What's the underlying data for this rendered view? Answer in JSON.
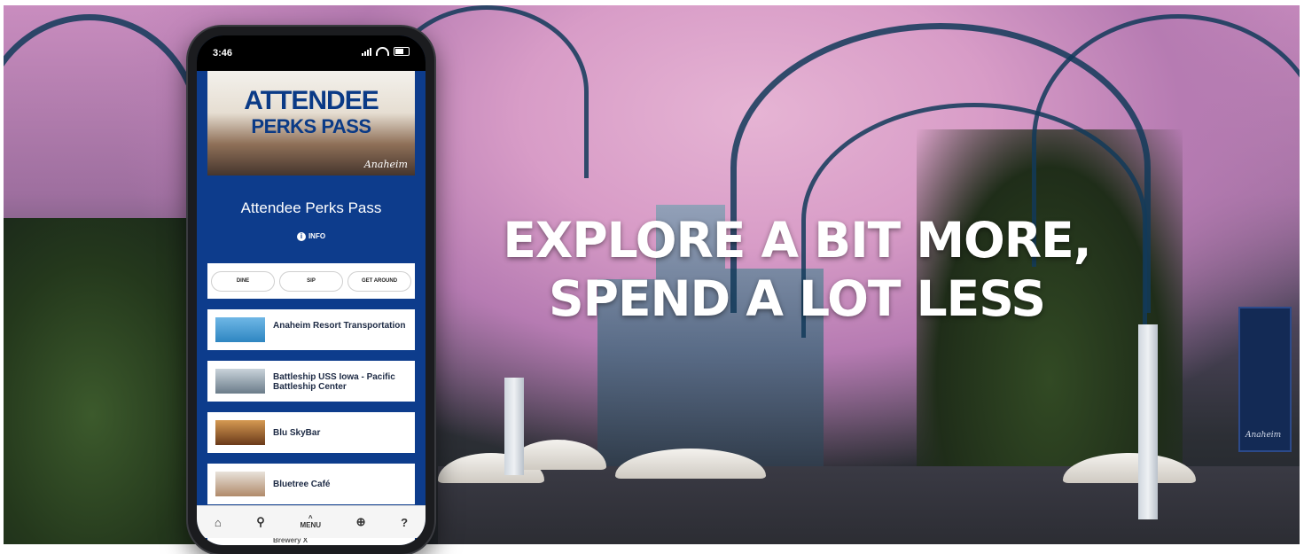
{
  "hero": {
    "headline_line1": "EXPLORE A BIT MORE,",
    "headline_line2": "SPEND A LOT LESS",
    "banner_signature": "Anaheim"
  },
  "phone": {
    "status_time": "3:46",
    "promo": {
      "title_line1": "ATTENDEE",
      "title_line2": "PERKS PASS",
      "logo_text": "Anaheim"
    },
    "section_title": "Attendee Perks Pass",
    "info_label": "INFO",
    "tabs": [
      "DINE",
      "SIP",
      "GET AROUND"
    ],
    "items": [
      {
        "label": "Anaheim Resort Transportation",
        "thumb_color": "#2e86c1"
      },
      {
        "label": "Battleship USS Iowa - Pacific Battleship Center",
        "thumb_color": "#6b7c8a"
      },
      {
        "label": "Blu SkyBar",
        "thumb_color": "#9a5a2a"
      },
      {
        "label": "Bluetree Café",
        "thumb_color": "#b08a6a"
      }
    ],
    "peek_item": "Brewery X",
    "nav": {
      "home_icon": "⌂",
      "location_icon": "⚲",
      "menu_chevron": "^",
      "menu_label": "MENU",
      "globe_icon": "⊕",
      "help_icon": "?"
    }
  },
  "colors": {
    "app_blue": "#0d3c8c",
    "sky_pink": "#d89cc7"
  }
}
